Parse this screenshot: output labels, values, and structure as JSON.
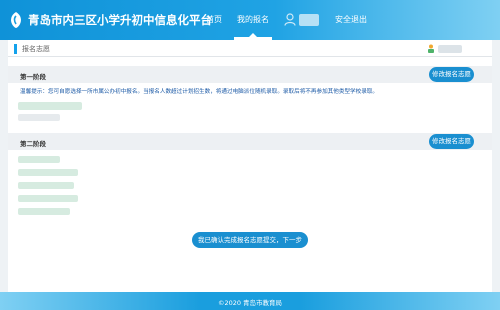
{
  "header": {
    "site_title": "青岛市内三区小学升初中信息化平台",
    "nav": {
      "home": "首页",
      "my_application": "我的报名",
      "logout": "安全退出"
    },
    "icons": {
      "logo": "logo-icon",
      "user": "user-icon"
    }
  },
  "breadcrumb": {
    "label": "报名志愿",
    "avatar_icon": "avatar-icon"
  },
  "stage1": {
    "title": "第一阶段",
    "edit_button": "修改报名志愿",
    "notice": "温馨提示：您可自愿选择一所市属公办初中报名。当报名人数超过计划招生数，将通过电脑派位随机录取。录取后将不再参加其他类型学校录取。"
  },
  "stage2": {
    "title": "第二阶段",
    "edit_button": "修改报名志愿"
  },
  "confirm_button": "我已确认完成报名志愿提交，下一步",
  "footer": {
    "text": "©2020 青岛市教育局"
  },
  "colors": {
    "header_start": "#0f92d8",
    "header_end": "#7fd0f3",
    "button": "#1a8fd0",
    "notice_text": "#1c5aa6",
    "stage_bg": "#edf0f3"
  }
}
